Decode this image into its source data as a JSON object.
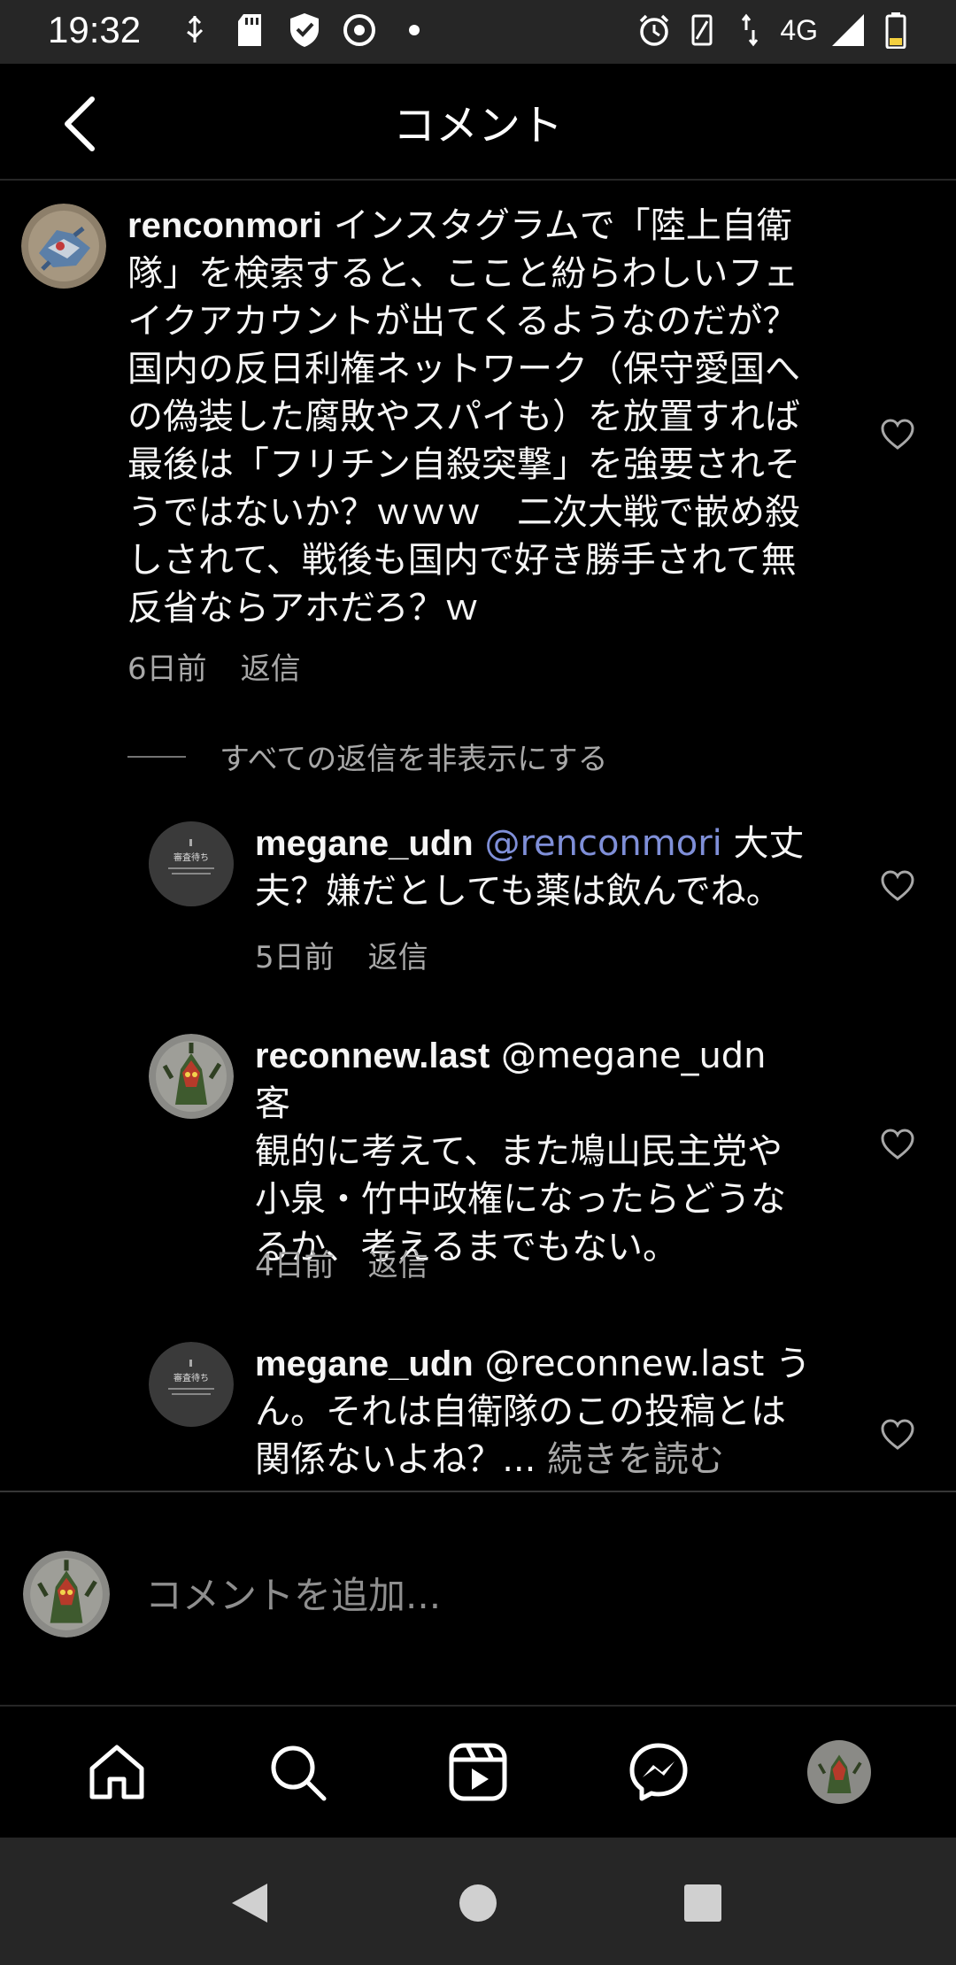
{
  "status_bar": {
    "time": "19:32",
    "network": "4G",
    "left_icons": [
      "usb-icon",
      "sd-card-icon",
      "shield-check-icon",
      "vpn-icon",
      "dot-icon"
    ],
    "right_icons": [
      "alarm-icon",
      "vibrate-icon",
      "data-arrows-icon",
      "signal-icon",
      "battery-icon"
    ]
  },
  "header": {
    "title": "コメント",
    "back_icon": "chevron-left-icon"
  },
  "comments": [
    {
      "username": "renconmori",
      "lines": [
        " インスタグラムで「陸上自衛",
        "隊」を検索すると、ここと紛らわしいフェ",
        "イクアカウントが出てくるようなのだが？",
        "国内の反日利権ネットワーク（保守愛国へ",
        "の偽装した腐敗やスパイも）を放置すれば",
        "最後は「フリチン自殺突撃」を強要されそ",
        "うではないか？ｗｗｗ　二次大戦で嵌め殺",
        "しされて、戦後も国内で好き勝手されて無",
        "反省ならアホだろ？ｗ"
      ],
      "time": "6日前",
      "reply": "返信"
    }
  ],
  "hide_replies": "すべての返信を非表示にする",
  "replies": [
    {
      "username": "megane_udn",
      "mention": "@renconmori",
      "line1_rest": " 大丈",
      "line2": "夫？嫌だとしても薬は飲んでね。",
      "time": "5日前",
      "reply": "返信",
      "avatar_label": "審査待ち"
    },
    {
      "username": "reconnew.last",
      "mention": "@megane_udn",
      "line1_rest": "　 客",
      "line2": "観的に考えて、また鳩山民主党や",
      "line3": "小泉・竹中政権になったらどうな",
      "line4": "るか、考えるまでもない。",
      "time": "4日前",
      "reply": "返信"
    },
    {
      "username": "megane_udn",
      "mention": "@reconnew.last",
      "line1_rest": " う",
      "line2": "ん。それは自衛隊のこの投稿とは",
      "line3_text": "関係ないよね？... ",
      "line3_more": "続きを読む",
      "avatar_label": "審査待ち"
    }
  ],
  "add_comment": {
    "placeholder": "コメントを追加..."
  },
  "bottom_nav": [
    "home-icon",
    "search-icon",
    "reels-icon",
    "messenger-icon",
    "profile-avatar"
  ],
  "colors": {
    "background": "#000000",
    "bar": "#262626",
    "mention": "#7f8fd8",
    "secondary_text": "#a8a8a8"
  }
}
